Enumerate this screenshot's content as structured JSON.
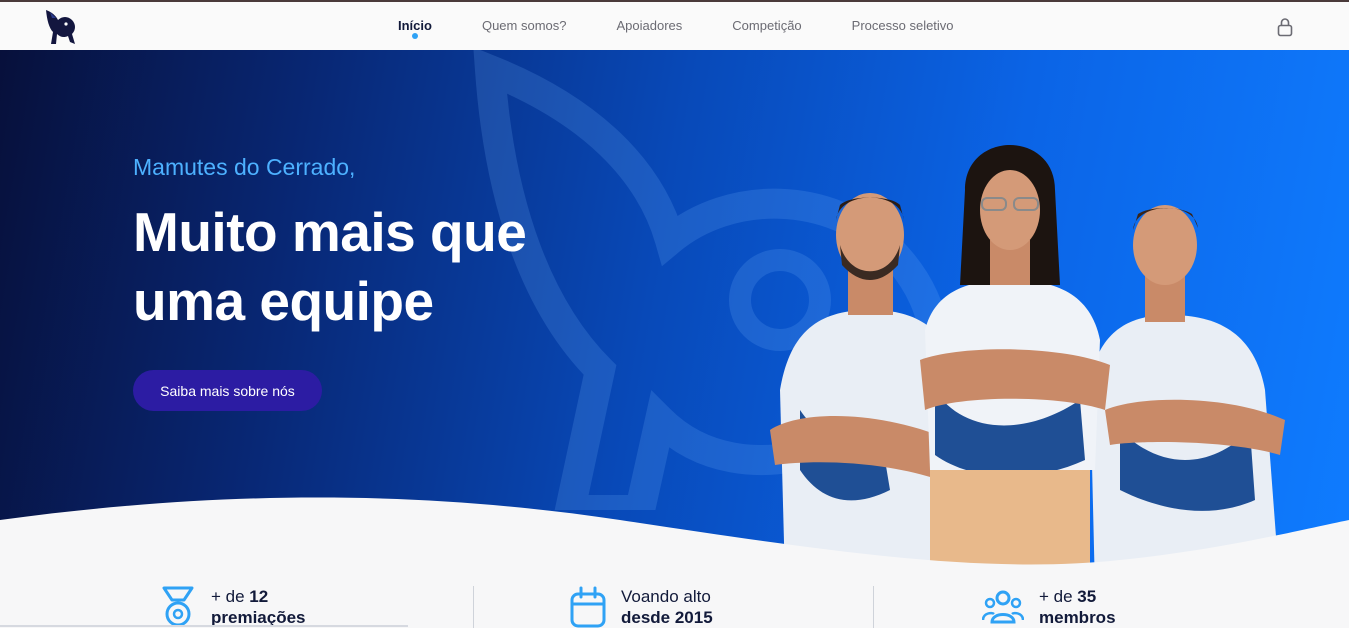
{
  "nav": {
    "items": [
      {
        "label": "Início",
        "active": true
      },
      {
        "label": "Quem somos?",
        "active": false
      },
      {
        "label": "Apoiadores",
        "active": false
      },
      {
        "label": "Competição",
        "active": false
      },
      {
        "label": "Processo seletivo",
        "active": false
      }
    ],
    "icons": {
      "logo": "mammoth-logo-icon",
      "login": "lock-icon"
    }
  },
  "hero": {
    "subtitle": "Mamutes do Cerrado,",
    "title_line1": "Muito mais que",
    "title_line2": "uma equipe",
    "cta_label": "Saiba mais sobre nós"
  },
  "stats": [
    {
      "icon": "medal-icon",
      "line1_prefix": "+ de ",
      "line1_value": "12",
      "line2": "premiações"
    },
    {
      "icon": "calendar-icon",
      "line1_prefix": "Voando alto",
      "line1_value": "",
      "line2": "desde 2015"
    },
    {
      "icon": "users-icon",
      "line1_prefix": "+ de ",
      "line1_value": "35",
      "line2": "membros"
    }
  ],
  "colors": {
    "accent": "#2fa2f5",
    "button": "#2c1ca3",
    "hero_dark": "#07103b",
    "hero_light": "#0f7cff",
    "text_dark": "#121a3a"
  }
}
